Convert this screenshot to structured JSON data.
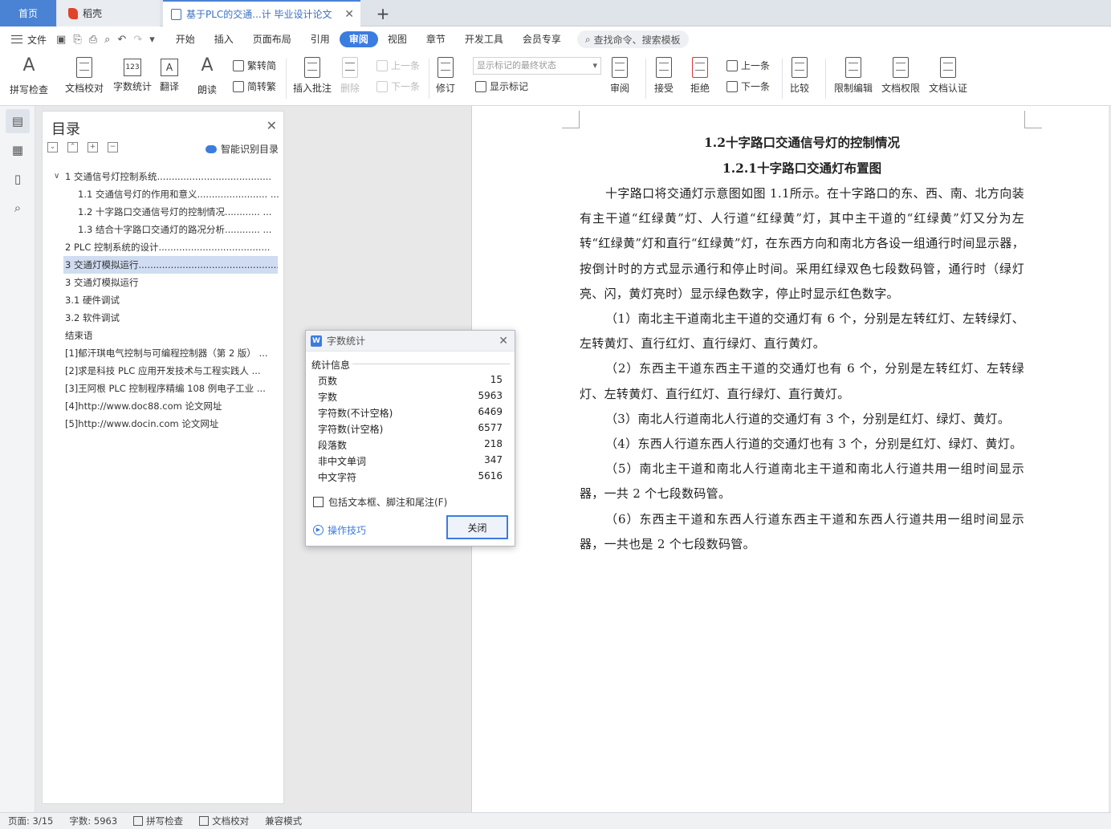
{
  "tabs": {
    "home": "首页",
    "daoke": "稻壳",
    "document": "基于PLC的交通...计 毕业设计论文",
    "add": "+"
  },
  "menu": {
    "file": "文件",
    "items": [
      "开始",
      "插入",
      "页面布局",
      "引用",
      "审阅",
      "视图",
      "章节",
      "开发工具",
      "会员专享"
    ],
    "active": "审阅",
    "search": "查找命令、搜索模板"
  },
  "ribbon": {
    "spellcheck": "拼写检查",
    "proofread": "文档校对",
    "wordcount": "字数统计",
    "translate": "翻译",
    "read_aloud": "朗读",
    "trad_to_simp": "繁转简",
    "simp_to_trad": "简转繁",
    "insert_comment": "插入批注",
    "delete": "删除",
    "prev_comment": "上一条",
    "next_comment": "下一条",
    "track_changes": "修订",
    "markup_state": "显示标记的最终状态",
    "show_markup": "显示标记",
    "review": "审阅",
    "accept": "接受",
    "reject": "拒绝",
    "prev": "上一条",
    "next": "下一条",
    "compare": "比较",
    "restrict_edit": "限制编辑",
    "doc_permission": "文档权限",
    "doc_certify": "文档认证"
  },
  "toc": {
    "title": "目录",
    "smart_label": "智能识别目录",
    "items": [
      {
        "text": "1 交通信号灯控制系统.......................................",
        "level": 1,
        "expanded": true
      },
      {
        "text": "1.1 交通信号灯的作用和意义........................ ...",
        "level": 2
      },
      {
        "text": "1.2 十字路口交通信号灯的控制情况............ ...",
        "level": 2
      },
      {
        "text": "1.3 结合十字路口交通灯的路况分析............ ...",
        "level": 2
      },
      {
        "text": "2 PLC 控制系统的设计......................................",
        "level": 1
      },
      {
        "text": "3 交通灯模拟运行..................................................",
        "level": 1,
        "selected": true
      },
      {
        "text": "3 交通灯模拟运行",
        "level": 1
      },
      {
        "text": "3.1 硬件调试",
        "level": 1
      },
      {
        "text": "3.2 软件调试",
        "level": 1
      },
      {
        "text": "结束语",
        "level": 1
      },
      {
        "text": "[1]郁汗琪电气控制与可编程控制器（第 2 版） ...",
        "level": 1
      },
      {
        "text": "[2]求是科技 PLC 应用开发技术与工程实践人 ...",
        "level": 1
      },
      {
        "text": "[3]王阿根 PLC 控制程序精编 108 例电子工业 ...",
        "level": 1
      },
      {
        "text": "[4]http://www.doc88.com 论文网址",
        "level": 1
      },
      {
        "text": "[5]http://www.docin.com 论文网址",
        "level": 1
      }
    ]
  },
  "document": {
    "heading1": "1.2十字路口交通信号灯的控制情况",
    "heading2": "1.2.1十字路口交通灯布置图",
    "paragraphs": [
      "十字路口将交通灯示意图如图 1.1所示。在十字路口的东、西、南、北方向装有主干道“红绿黄”灯、人行道“红绿黄”灯，其中主干道的“红绿黄”灯又分为左转“红绿黄”灯和直行“红绿黄”灯，在东西方向和南北方各设一组通行时间显示器，按倒计时的方式显示通行和停止时间。采用红绿双色七段数码管，通行时（绿灯亮、闪，黄灯亮时）显示绿色数字，停止时显示红色数字。",
      "（1）南北主干道南北主干道的交通灯有 6 个，分别是左转红灯、左转绿灯、左转黄灯、直行红灯、直行绿灯、直行黄灯。",
      "（2）东西主干道东西主干道的交通灯也有 6 个，分别是左转红灯、左转绿灯、左转黄灯、直行红灯、直行绿灯、直行黄灯。",
      "（3）南北人行道南北人行道的交通灯有 3 个，分别是红灯、绿灯、黄灯。",
      "（4）东西人行道东西人行道的交通灯也有 3 个，分别是红灯、绿灯、黄灯。",
      "（5）南北主干道和南北人行道南北主干道和南北人行道共用一组时间显示器，一共 2 个七段数码管。",
      "（6）东西主干道和东西人行道东西主干道和东西人行道共用一组时间显示器，一共也是 2 个七段数码管。"
    ]
  },
  "dialog": {
    "title": "字数统计",
    "section": "统计信息",
    "rows": [
      {
        "label": "页数",
        "value": "15"
      },
      {
        "label": "字数",
        "value": "5963"
      },
      {
        "label": "字符数(不计空格)",
        "value": "6469"
      },
      {
        "label": "字符数(计空格)",
        "value": "6577"
      },
      {
        "label": "段落数",
        "value": "218"
      },
      {
        "label": "非中文单词",
        "value": "347"
      },
      {
        "label": "中文字符",
        "value": "5616"
      }
    ],
    "checkbox": "包括文本框、脚注和尾注(F)",
    "tips": "操作技巧",
    "close": "关闭"
  },
  "status": {
    "page": "页面: 3/15",
    "words": "字数: 5963",
    "spellcheck": "拼写检查",
    "proofread": "文档校对",
    "compat": "兼容模式"
  }
}
